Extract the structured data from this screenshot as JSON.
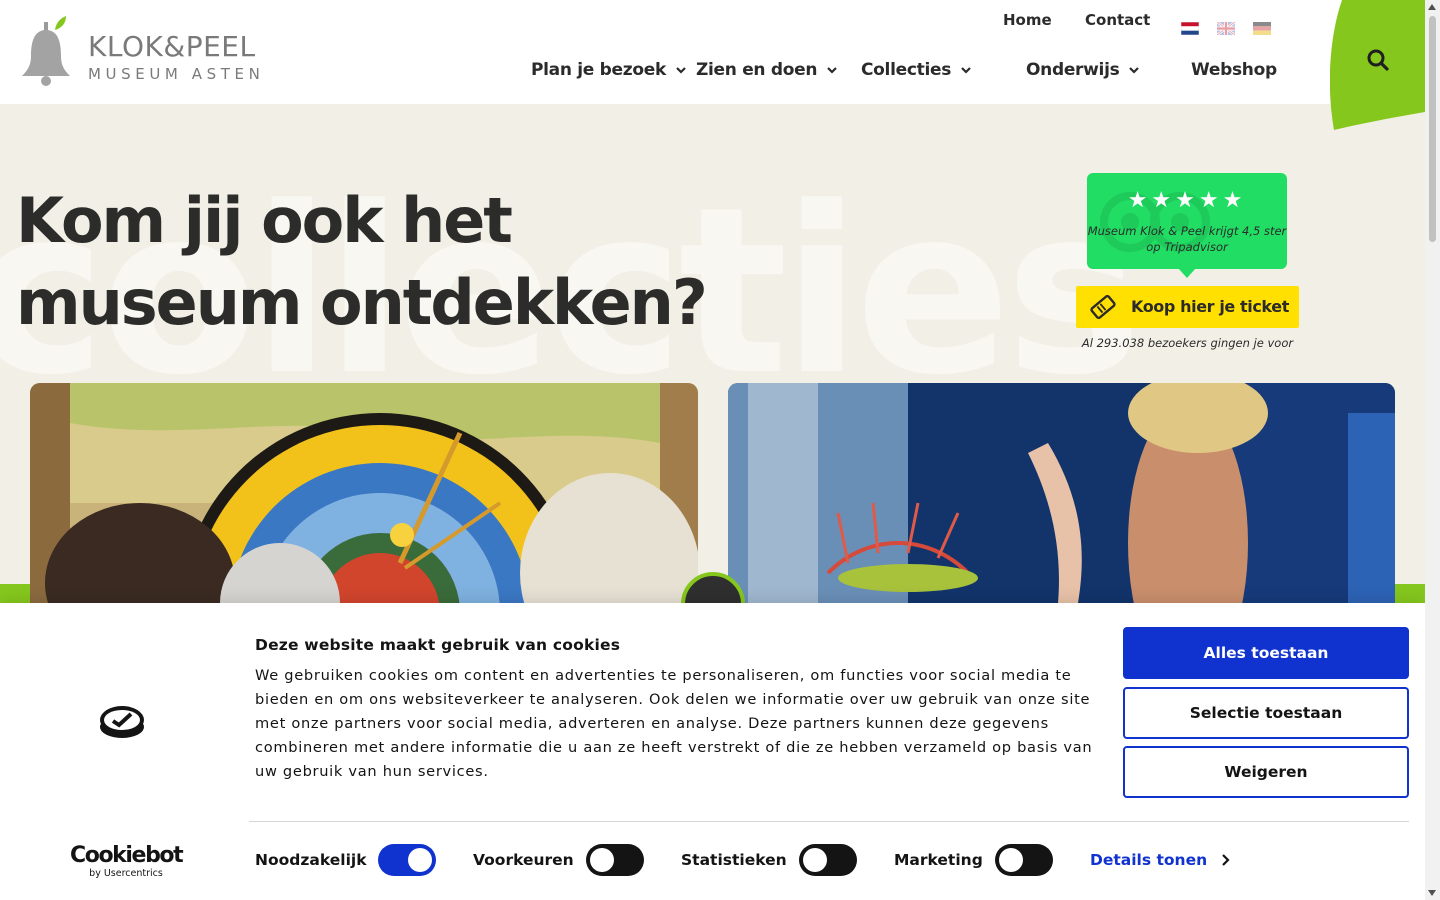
{
  "brand": {
    "name_line1": "KLOK&PEEL",
    "name_line2": "MUSEUM ASTEN",
    "green": "#86c71e",
    "dark": "#2c2c2a"
  },
  "top_nav": {
    "home": "Home",
    "contact": "Contact",
    "flags": [
      "flag-nl-icon",
      "flag-gb-icon",
      "flag-de-icon"
    ]
  },
  "main_nav": [
    {
      "label": "Plan je bezoek",
      "has_dropdown": true
    },
    {
      "label": "Zien en doen",
      "has_dropdown": true
    },
    {
      "label": "Collecties",
      "has_dropdown": true
    },
    {
      "label": "Onderwijs",
      "has_dropdown": true
    },
    {
      "label": "Webshop",
      "has_dropdown": false
    }
  ],
  "hero": {
    "title": "Kom jij ook het museum ontdekken?",
    "background_word": "collecties"
  },
  "tripadvisor": {
    "rating": 4.5,
    "text": "Museum Klok & Peel krijgt 4,5 ster op Tripadvisor",
    "badge_color": "#22dd64"
  },
  "ticket": {
    "label": "Koop hier je ticket",
    "visitors_text": "Al 293.038 bezoekers gingen je voor",
    "color": "#ffe000"
  },
  "cookie_banner": {
    "title": "Deze website maakt gebruik van cookies",
    "text": "We gebruiken cookies om content en advertenties te personaliseren, om functies voor social media te bieden en om ons websiteverkeer te analyseren. Ook delen we informatie over uw gebruik van onze site met onze partners voor social media, adverteren en analyse. Deze partners kunnen deze gegevens combineren met andere informatie die u aan ze heeft verstrekt of die ze hebben verzameld op basis van uw gebruik van hun services.",
    "buttons": {
      "allow_all": "Alles toestaan",
      "allow_selection": "Selectie toestaan",
      "deny": "Weigeren"
    },
    "provider": {
      "name": "Cookiebot",
      "sub": "by Usercentrics"
    },
    "toggles": [
      {
        "label": "Noodzakelijk",
        "on": true
      },
      {
        "label": "Voorkeuren",
        "on": false
      },
      {
        "label": "Statistieken",
        "on": false
      },
      {
        "label": "Marketing",
        "on": false
      }
    ],
    "details_link": "Details tonen",
    "accent": "#1032cf"
  }
}
